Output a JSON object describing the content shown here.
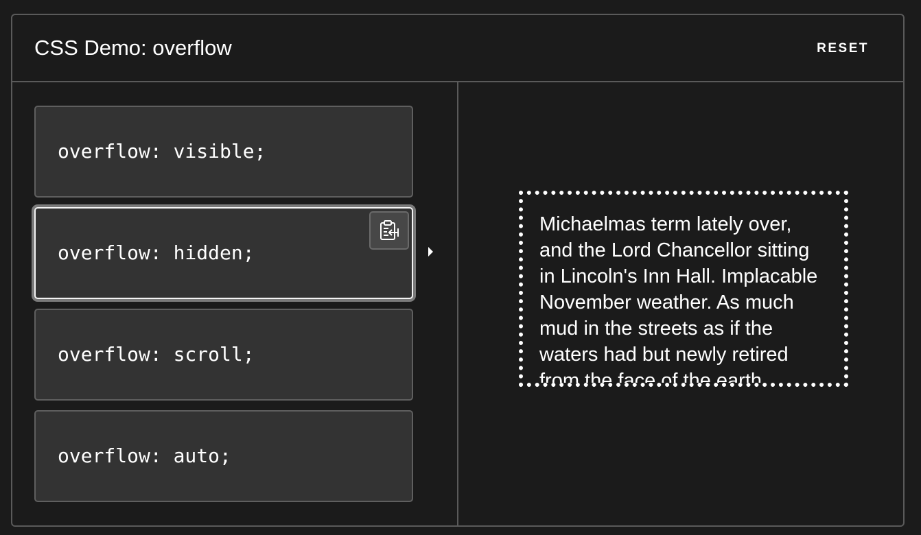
{
  "header": {
    "title": "CSS Demo: overflow",
    "reset_label": "RESET"
  },
  "options": [
    {
      "code": "overflow: visible;"
    },
    {
      "code": "overflow: hidden;",
      "selected": true
    },
    {
      "code": "overflow: scroll;"
    },
    {
      "code": "overflow: auto;"
    }
  ],
  "copy_button": {
    "icon": "clipboard-copy-icon"
  },
  "output": {
    "text": "Michaelmas term lately over, and the Lord Chancellor sitting in Lincoln's Inn Hall. Implacable November weather. As much mud in the streets as if the waters had but newly retired from the face of the earth."
  },
  "colors": {
    "background": "#1b1b1b",
    "border": "#5a5a5a",
    "option_bg": "#333333",
    "text": "#ffffff"
  }
}
